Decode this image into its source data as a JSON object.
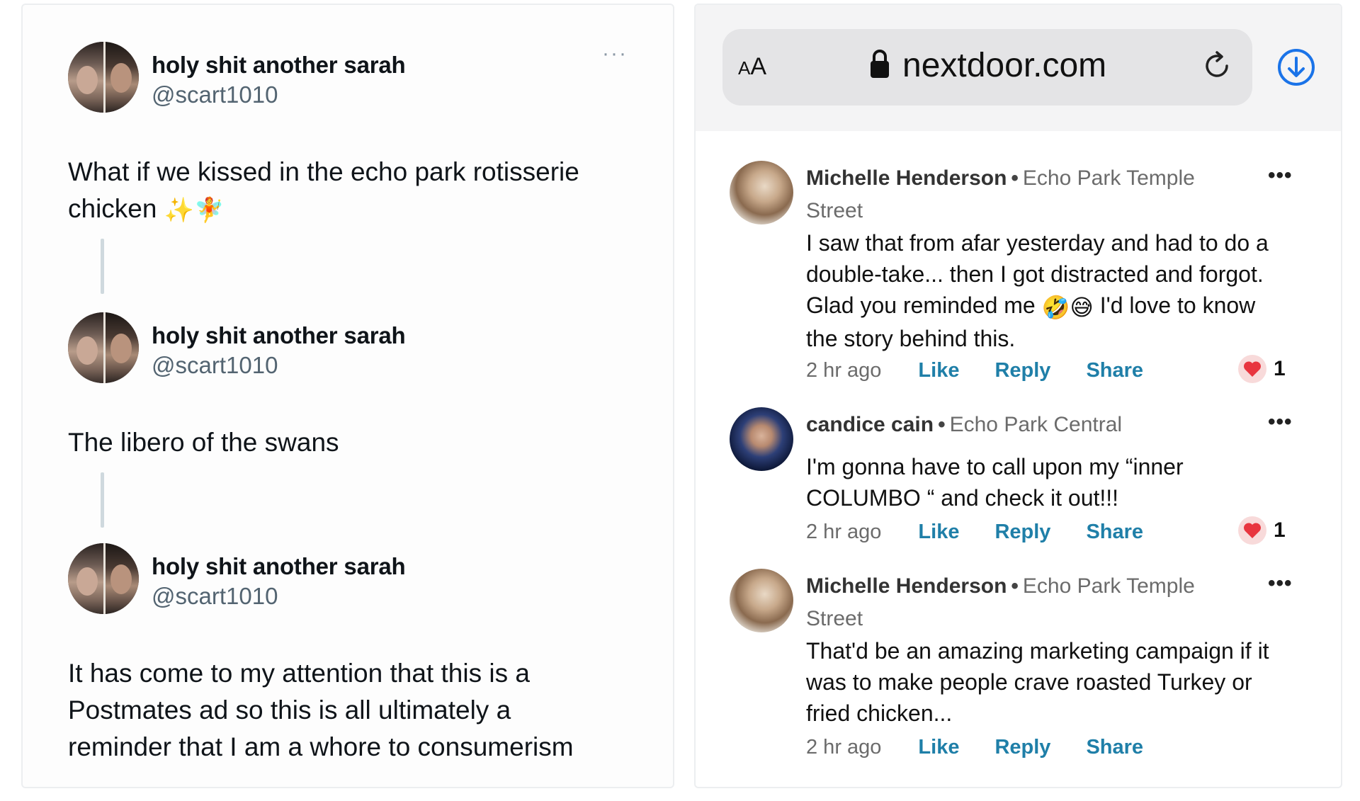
{
  "tweets": [
    {
      "author_name": "holy shit another sarah",
      "handle": "@scart1010",
      "text_lines": [
        "What if we kissed in the echo park rotisserie",
        "chicken"
      ],
      "emojis": [
        "✨",
        "🧚"
      ]
    },
    {
      "author_name": "holy shit another sarah",
      "handle": "@scart1010",
      "text": "The libero of the swans"
    },
    {
      "author_name": "holy shit another sarah",
      "handle": "@scart1010",
      "text_lines": [
        "It has come to my attention that this is a",
        "Postmates ad so this is all ultimately a",
        "reminder that I am a whore to consumerism"
      ]
    }
  ],
  "tweet_menu": "···",
  "browser": {
    "aa_label_big": "A",
    "aa_label_small": "A",
    "url": "nextdoor.com",
    "accent_color": "#1a73e8"
  },
  "comments": [
    {
      "name": "Michelle Henderson",
      "separator": "•",
      "location_line1": "Echo Park Temple",
      "location_line2": "Street",
      "text_lines": [
        "I saw that from afar yesterday and had to do a",
        "double-take... then I got distracted and forgot.",
        "Glad you reminded me",
        "I'd love to know",
        "the story behind this."
      ],
      "emojis": [
        "🤣",
        "😅"
      ],
      "time": "2 hr ago",
      "actions": [
        "Like",
        "Reply",
        "Share"
      ],
      "reaction_count": "1"
    },
    {
      "name": "candice cain",
      "separator": "•",
      "location_line1": "Echo Park Central",
      "text_lines": [
        "I'm gonna have to call upon my “inner",
        "COLUMBO “ and check it out!!!"
      ],
      "time": "2 hr ago",
      "actions": [
        "Like",
        "Reply",
        "Share"
      ],
      "reaction_count": "1"
    },
    {
      "name": "Michelle Henderson",
      "separator": "•",
      "location_line1": "Echo Park Temple",
      "location_line2": "Street",
      "text_lines": [
        "That'd be an amazing marketing campaign if it",
        "was to make people crave roasted Turkey or",
        "fried chicken..."
      ],
      "time": "2 hr ago",
      "actions": [
        "Like",
        "Reply",
        "Share"
      ]
    }
  ],
  "comment_menu": "•••",
  "colors": {
    "action_blue": "#1f7fa8",
    "heart_red": "#e8353f",
    "thread_line": "#cfd9de"
  }
}
